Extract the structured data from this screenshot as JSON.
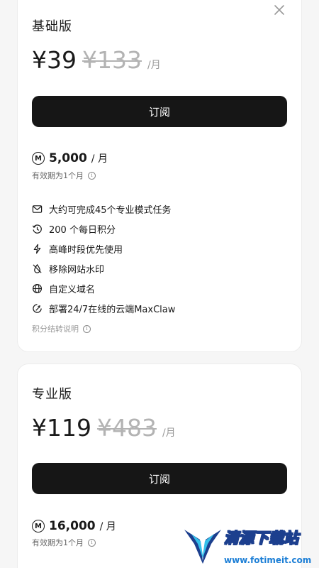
{
  "plans": [
    {
      "name": "基础版",
      "price": "¥39",
      "original_price": "¥133",
      "per": "/月",
      "subscribe_label": "订阅",
      "credits": "5,000",
      "credits_unit": "/ 月",
      "validity": "有效期为1个月",
      "features": [
        {
          "icon": "mail-icon",
          "text": "大约可完成45个专业模式任务"
        },
        {
          "icon": "history-icon",
          "text": "200 个每日积分"
        },
        {
          "icon": "lightning-icon",
          "text": "高峰时段优先使用"
        },
        {
          "icon": "no-watermark-icon",
          "text": "移除网站水印"
        },
        {
          "icon": "globe-icon",
          "text": "自定义域名"
        },
        {
          "icon": "claw-icon",
          "text": "部署24/7在线的云端MaxClaw"
        }
      ],
      "explain": "积分结转说明"
    },
    {
      "name": "专业版",
      "price": "¥119",
      "original_price": "¥483",
      "per": "/月",
      "subscribe_label": "订阅",
      "credits": "16,000",
      "credits_unit": "/ 月",
      "validity": "有效期为1个月"
    }
  ],
  "coin_glyph": "M",
  "info_glyph": "i",
  "watermark": {
    "title": "清源下载站",
    "url": "www.fotimeit.com"
  },
  "colors": {
    "button_bg": "#161616",
    "accent_watermark": "#1d7fd6"
  }
}
